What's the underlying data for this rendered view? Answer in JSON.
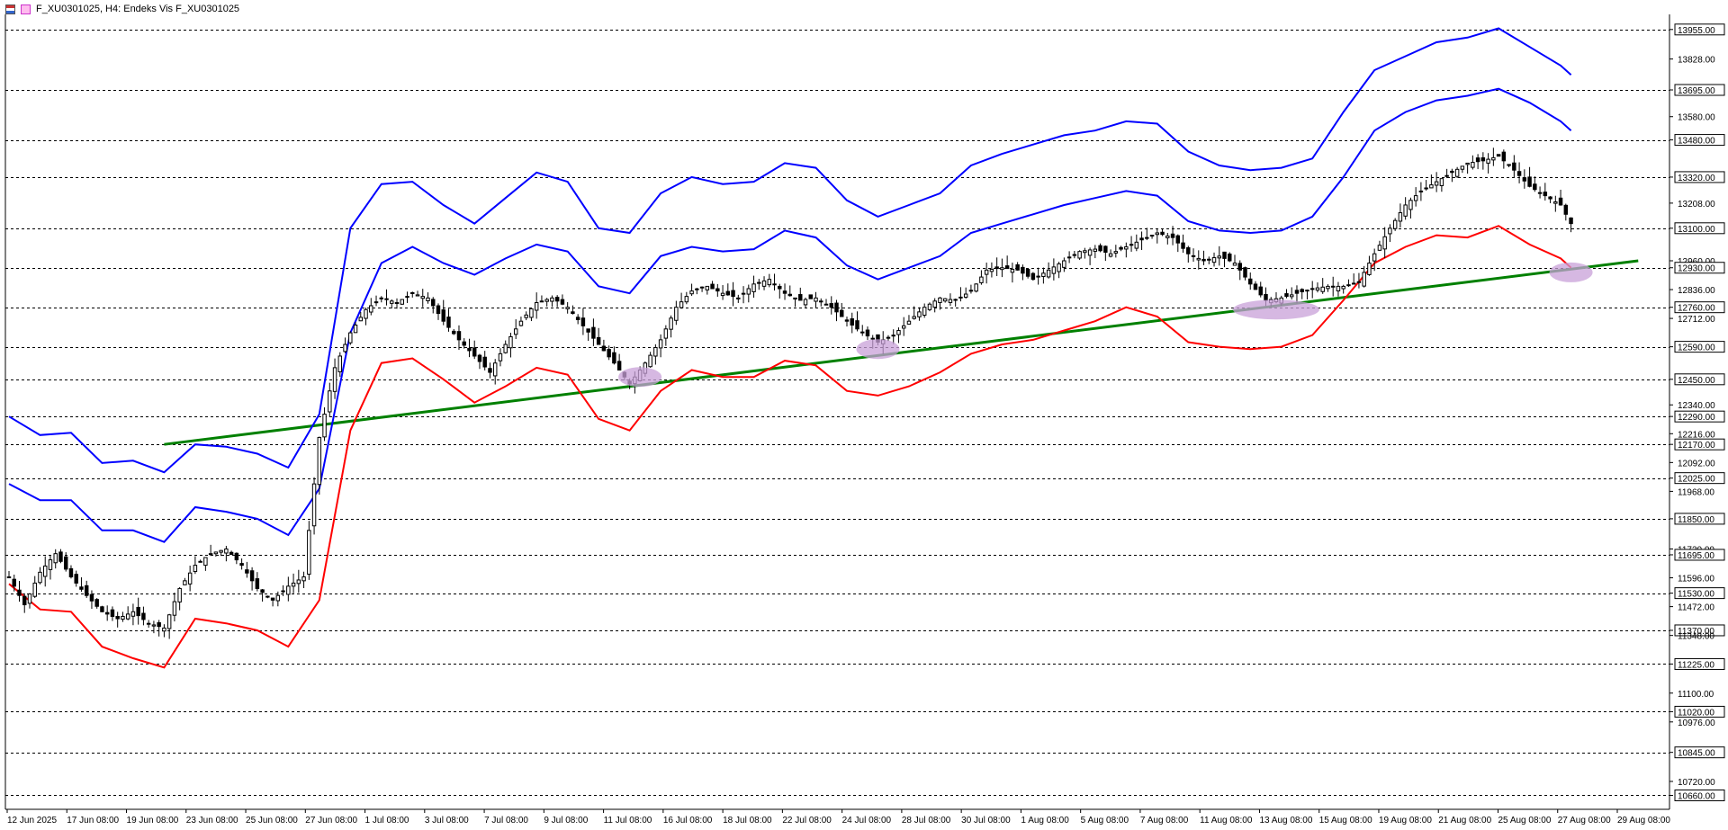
{
  "header": {
    "title": "F_XU0301025, H4:  Endeks Vis F_XU0301025"
  },
  "colors": {
    "band_outer": "#0000ff",
    "band_lower": "#ff0000",
    "trendline": "#008000",
    "highlight": "#c8a0d8",
    "grid": "#000000"
  },
  "chart_data": {
    "type": "candlestick",
    "title": "F_XU0301025, H4:  Endeks Vis F_XU0301025",
    "ylim": [
      10600,
      14020
    ],
    "y_tick_labels": [
      "13955.00",
      "13828.00",
      "13695.00",
      "13580.00",
      "13480.00",
      "13320.00",
      "13208.00",
      "13100.00",
      "12960.00",
      "12930.00",
      "12836.00",
      "12760.00",
      "12712.00",
      "12590.00",
      "12450.00",
      "12340.00",
      "12290.00",
      "12216.00",
      "12170.00",
      "12092.00",
      "12025.00",
      "11968.00",
      "11850.00",
      "11720.00",
      "11695.00",
      "11596.00",
      "11530.00",
      "11472.00",
      "11370.00",
      "11348.00",
      "11225.00",
      "11100.00",
      "11020.00",
      "10976.00",
      "10845.00",
      "10720.00",
      "10660.00"
    ],
    "horizontal_levels": [
      13955,
      13695,
      13480,
      13320,
      13100,
      12930,
      12760,
      12590,
      12450,
      12290,
      12170,
      12025,
      11850,
      11695,
      11530,
      11370,
      11225,
      11020,
      10845,
      10660
    ],
    "x_tick_labels": [
      "12 Jun 2025",
      "17 Jun 08:00",
      "19 Jun 08:00",
      "23 Jun 08:00",
      "25 Jun 08:00",
      "27 Jun 08:00",
      "1 Jul 08:00",
      "3 Jul 08:00",
      "7 Jul 08:00",
      "9 Jul 08:00",
      "11 Jul 08:00",
      "16 Jul 08:00",
      "18 Jul 08:00",
      "22 Jul 08:00",
      "24 Jul 08:00",
      "28 Jul 08:00",
      "30 Jul 08:00",
      "1 Aug 08:00",
      "5 Aug 08:00",
      "7 Aug 08:00",
      "11 Aug 08:00",
      "13 Aug 08:00",
      "15 Aug 08:00",
      "19 Aug 08:00",
      "21 Aug 08:00",
      "25 Aug 08:00",
      "27 Aug 08:00",
      "29 Aug 08:00"
    ],
    "close_path": [
      [
        0,
        11600
      ],
      [
        3,
        11480
      ],
      [
        6,
        11620
      ],
      [
        9,
        11700
      ],
      [
        12,
        11600
      ],
      [
        15,
        11520
      ],
      [
        18,
        11450
      ],
      [
        21,
        11420
      ],
      [
        24,
        11450
      ],
      [
        27,
        11400
      ],
      [
        30,
        11380
      ],
      [
        33,
        11550
      ],
      [
        36,
        11650
      ],
      [
        39,
        11700
      ],
      [
        42,
        11720
      ],
      [
        45,
        11650
      ],
      [
        48,
        11550
      ],
      [
        51,
        11500
      ],
      [
        54,
        11560
      ],
      [
        57,
        11600
      ],
      [
        60,
        12200
      ],
      [
        63,
        12500
      ],
      [
        66,
        12650
      ],
      [
        69,
        12750
      ],
      [
        72,
        12800
      ],
      [
        75,
        12780
      ],
      [
        78,
        12820
      ],
      [
        81,
        12800
      ],
      [
        84,
        12700
      ],
      [
        87,
        12620
      ],
      [
        90,
        12550
      ],
      [
        93,
        12480
      ],
      [
        96,
        12600
      ],
      [
        99,
        12700
      ],
      [
        102,
        12780
      ],
      [
        105,
        12800
      ],
      [
        108,
        12760
      ],
      [
        111,
        12680
      ],
      [
        114,
        12600
      ],
      [
        117,
        12520
      ],
      [
        120,
        12430
      ],
      [
        123,
        12520
      ],
      [
        126,
        12620
      ],
      [
        129,
        12760
      ],
      [
        132,
        12830
      ],
      [
        135,
        12850
      ],
      [
        138,
        12820
      ],
      [
        141,
        12800
      ],
      [
        144,
        12860
      ],
      [
        147,
        12880
      ],
      [
        150,
        12820
      ],
      [
        153,
        12790
      ],
      [
        156,
        12800
      ],
      [
        159,
        12760
      ],
      [
        162,
        12700
      ],
      [
        165,
        12650
      ],
      [
        168,
        12610
      ],
      [
        171,
        12640
      ],
      [
        174,
        12700
      ],
      [
        177,
        12760
      ],
      [
        180,
        12800
      ],
      [
        183,
        12790
      ],
      [
        186,
        12830
      ],
      [
        189,
        12920
      ],
      [
        192,
        12930
      ],
      [
        195,
        12920
      ],
      [
        198,
        12880
      ],
      [
        201,
        12920
      ],
      [
        204,
        12960
      ],
      [
        207,
        13000
      ],
      [
        210,
        13010
      ],
      [
        213,
        12990
      ],
      [
        216,
        13020
      ],
      [
        219,
        13050
      ],
      [
        222,
        13080
      ],
      [
        225,
        13060
      ],
      [
        228,
        12990
      ],
      [
        231,
        12960
      ],
      [
        234,
        12980
      ],
      [
        237,
        12950
      ],
      [
        240,
        12860
      ],
      [
        243,
        12790
      ],
      [
        246,
        12800
      ],
      [
        249,
        12820
      ],
      [
        252,
        12840
      ],
      [
        255,
        12850
      ],
      [
        258,
        12850
      ],
      [
        261,
        12870
      ],
      [
        264,
        12990
      ],
      [
        267,
        13100
      ],
      [
        270,
        13200
      ],
      [
        273,
        13260
      ],
      [
        276,
        13300
      ],
      [
        279,
        13340
      ],
      [
        282,
        13380
      ],
      [
        285,
        13390
      ],
      [
        288,
        13410
      ],
      [
        291,
        13350
      ],
      [
        294,
        13280
      ],
      [
        297,
        13240
      ],
      [
        300,
        13200
      ],
      [
        302,
        13120
      ]
    ],
    "volatility_band_outer": [
      [
        0,
        12290
      ],
      [
        6,
        12210
      ],
      [
        12,
        12220
      ],
      [
        18,
        12090
      ],
      [
        24,
        12100
      ],
      [
        30,
        12050
      ],
      [
        36,
        12170
      ],
      [
        42,
        12160
      ],
      [
        48,
        12130
      ],
      [
        54,
        12070
      ],
      [
        60,
        12300
      ],
      [
        66,
        13100
      ],
      [
        72,
        13290
      ],
      [
        78,
        13300
      ],
      [
        84,
        13200
      ],
      [
        90,
        13120
      ],
      [
        96,
        13230
      ],
      [
        102,
        13340
      ],
      [
        108,
        13300
      ],
      [
        114,
        13100
      ],
      [
        120,
        13080
      ],
      [
        126,
        13250
      ],
      [
        132,
        13320
      ],
      [
        138,
        13290
      ],
      [
        144,
        13300
      ],
      [
        150,
        13380
      ],
      [
        156,
        13360
      ],
      [
        162,
        13220
      ],
      [
        168,
        13150
      ],
      [
        174,
        13200
      ],
      [
        180,
        13250
      ],
      [
        186,
        13370
      ],
      [
        192,
        13420
      ],
      [
        198,
        13460
      ],
      [
        204,
        13500
      ],
      [
        210,
        13520
      ],
      [
        216,
        13560
      ],
      [
        222,
        13550
      ],
      [
        228,
        13430
      ],
      [
        234,
        13370
      ],
      [
        240,
        13350
      ],
      [
        246,
        13360
      ],
      [
        252,
        13400
      ],
      [
        258,
        13600
      ],
      [
        264,
        13780
      ],
      [
        270,
        13840
      ],
      [
        276,
        13900
      ],
      [
        282,
        13920
      ],
      [
        288,
        13960
      ],
      [
        294,
        13880
      ],
      [
        300,
        13800
      ],
      [
        302,
        13760
      ]
    ],
    "volatility_band_middle": [
      [
        0,
        12000
      ],
      [
        6,
        11930
      ],
      [
        12,
        11930
      ],
      [
        18,
        11800
      ],
      [
        24,
        11800
      ],
      [
        30,
        11750
      ],
      [
        36,
        11900
      ],
      [
        42,
        11880
      ],
      [
        48,
        11850
      ],
      [
        54,
        11780
      ],
      [
        60,
        11980
      ],
      [
        66,
        12650
      ],
      [
        72,
        12950
      ],
      [
        78,
        13020
      ],
      [
        84,
        12950
      ],
      [
        90,
        12900
      ],
      [
        96,
        12970
      ],
      [
        102,
        13030
      ],
      [
        108,
        13000
      ],
      [
        114,
        12850
      ],
      [
        120,
        12820
      ],
      [
        126,
        12980
      ],
      [
        132,
        13020
      ],
      [
        138,
        13000
      ],
      [
        144,
        13010
      ],
      [
        150,
        13090
      ],
      [
        156,
        13060
      ],
      [
        162,
        12940
      ],
      [
        168,
        12880
      ],
      [
        174,
        12930
      ],
      [
        180,
        12980
      ],
      [
        186,
        13080
      ],
      [
        192,
        13120
      ],
      [
        198,
        13160
      ],
      [
        204,
        13200
      ],
      [
        210,
        13230
      ],
      [
        216,
        13260
      ],
      [
        222,
        13240
      ],
      [
        228,
        13130
      ],
      [
        234,
        13090
      ],
      [
        240,
        13080
      ],
      [
        246,
        13090
      ],
      [
        252,
        13150
      ],
      [
        258,
        13320
      ],
      [
        264,
        13520
      ],
      [
        270,
        13600
      ],
      [
        276,
        13650
      ],
      [
        282,
        13670
      ],
      [
        288,
        13700
      ],
      [
        294,
        13640
      ],
      [
        300,
        13560
      ],
      [
        302,
        13520
      ]
    ],
    "volatility_band_lower": [
      [
        0,
        11570
      ],
      [
        6,
        11460
      ],
      [
        12,
        11450
      ],
      [
        18,
        11300
      ],
      [
        24,
        11250
      ],
      [
        30,
        11210
      ],
      [
        36,
        11420
      ],
      [
        42,
        11400
      ],
      [
        48,
        11370
      ],
      [
        54,
        11300
      ],
      [
        60,
        11500
      ],
      [
        66,
        12230
      ],
      [
        72,
        12520
      ],
      [
        78,
        12540
      ],
      [
        84,
        12450
      ],
      [
        90,
        12350
      ],
      [
        96,
        12420
      ],
      [
        102,
        12500
      ],
      [
        108,
        12470
      ],
      [
        114,
        12280
      ],
      [
        120,
        12230
      ],
      [
        126,
        12400
      ],
      [
        132,
        12490
      ],
      [
        138,
        12460
      ],
      [
        144,
        12460
      ],
      [
        150,
        12530
      ],
      [
        156,
        12510
      ],
      [
        162,
        12400
      ],
      [
        168,
        12380
      ],
      [
        174,
        12420
      ],
      [
        180,
        12480
      ],
      [
        186,
        12560
      ],
      [
        192,
        12600
      ],
      [
        198,
        12620
      ],
      [
        204,
        12660
      ],
      [
        210,
        12700
      ],
      [
        216,
        12760
      ],
      [
        222,
        12720
      ],
      [
        228,
        12610
      ],
      [
        234,
        12590
      ],
      [
        240,
        12580
      ],
      [
        246,
        12590
      ],
      [
        252,
        12640
      ],
      [
        258,
        12790
      ],
      [
        264,
        12950
      ],
      [
        270,
        13020
      ],
      [
        276,
        13070
      ],
      [
        282,
        13060
      ],
      [
        288,
        13110
      ],
      [
        294,
        13030
      ],
      [
        300,
        12970
      ],
      [
        302,
        12930
      ]
    ],
    "trendline": {
      "start": [
        30,
        12170
      ],
      "end": [
        315,
        12960
      ]
    },
    "highlights": [
      [
        122,
        12460
      ],
      [
        168,
        12580
      ],
      [
        245,
        12750
      ],
      [
        302,
        12910
      ]
    ]
  }
}
